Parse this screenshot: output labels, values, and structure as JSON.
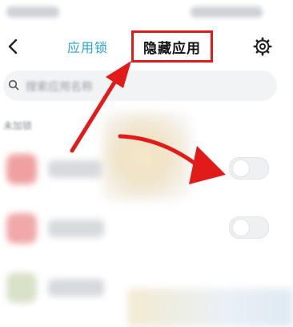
{
  "header": {
    "tab_applock": "应用锁",
    "tab_hidden": "隐藏应用"
  },
  "search": {
    "placeholder": "搜索应用名称"
  },
  "section": {
    "label": "未加锁"
  },
  "apps": [
    {
      "icon_color": "#f0a0a0",
      "enabled": false
    },
    {
      "icon_color": "#f0a8a8",
      "enabled": false
    },
    {
      "icon_color": "#d9e2c8",
      "enabled": false
    }
  ],
  "colors": {
    "accent": "#2aa6c7",
    "annotation_red": "#e11a1a",
    "search_bg": "#f1f3f5"
  },
  "icons": [
    "back-icon",
    "gear-icon",
    "search-icon",
    "toggle-switch"
  ]
}
